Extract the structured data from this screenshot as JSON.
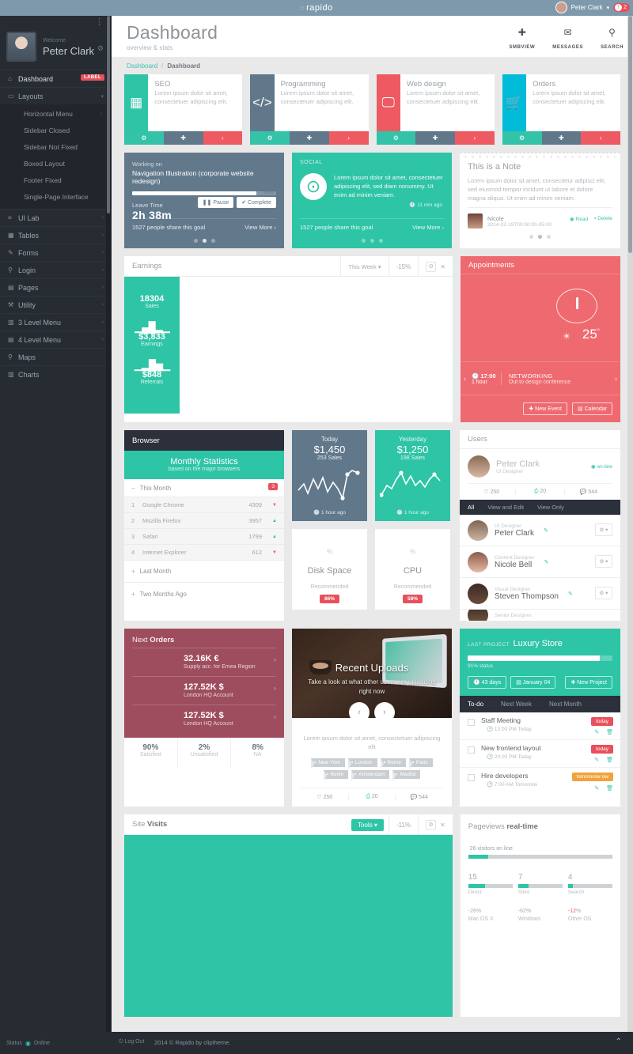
{
  "topbar": {
    "brand": "rapido",
    "user_name": "Peter Clark",
    "alert_count": "2"
  },
  "sidebar": {
    "welcome": "Welcome",
    "user": "Peter Clark",
    "dashboard": {
      "label": "Dashboard",
      "badge": "LABEL"
    },
    "layouts": {
      "label": "Layouts"
    },
    "layout_items": [
      {
        "label": "Horizontal Menu"
      },
      {
        "label": "Sidebar Closed"
      },
      {
        "label": "Sidebar Not Fixed"
      },
      {
        "label": "Boxed Layout"
      },
      {
        "label": "Footer Fixed"
      },
      {
        "label": "Single-Page Interface"
      }
    ],
    "items": [
      {
        "label": "UI Lab"
      },
      {
        "label": "Tables"
      },
      {
        "label": "Forms"
      },
      {
        "label": "Login"
      },
      {
        "label": "Pages"
      },
      {
        "label": "Utility"
      },
      {
        "label": "3 Level Menu"
      },
      {
        "label": "4 Level Menu"
      },
      {
        "label": "Maps"
      },
      {
        "label": "Charts"
      }
    ]
  },
  "page": {
    "title": "Dashboard",
    "subtitle": "overview & stats",
    "actions": [
      {
        "label": "SMBVIEW"
      },
      {
        "label": "MESSAGES"
      },
      {
        "label": "SEARCH"
      }
    ],
    "breadcrumb_root": "Dashboard",
    "breadcrumb_sep": "/",
    "breadcrumb_current": "Dashboard"
  },
  "services": [
    {
      "title": "SEO",
      "desc": "Lorem ipsum dolor sit amet, consectetuer adipiscing elit.",
      "color": "bg-teal"
    },
    {
      "title": "Programming",
      "desc": "Lorem ipsum dolor sit amet, consectetuer adipiscing elit.",
      "color": "bg-slate"
    },
    {
      "title": "Web design",
      "desc": "Lorem ipsum dolor sit amet, consectetuer adipiscing elit.",
      "color": "bg-red"
    },
    {
      "title": "Orders",
      "desc": "Lorem ipsum dolor sit amet, consectetuer adipiscing elit.",
      "color": "bg-cyan"
    }
  ],
  "working": {
    "label": "Working on",
    "title": "Navigation Illustration (corporate website redesign)",
    "progress": "86%",
    "leave_label": "Leave Time",
    "time": "2h 38m",
    "pause": "Pause",
    "complete": "Complete",
    "share_count": "1527",
    "share_text": "people share this goal",
    "view_more": "View More"
  },
  "social": {
    "label": "SOCIAL",
    "text": "Lorem ipsum dolor sit amet, consectetuer adipiscing elit, sed diam nonummy. Ut enim ad minim veniam.",
    "ago": "11 min ago",
    "share_count": "1527",
    "share_text": "people share this goal",
    "view_more": "View More"
  },
  "note": {
    "title": "This is a Note",
    "text": "Lorem ipsum dolor sit amet, consectetur adipisci elit, sed eiusmod tempor incidunt ut labore et dolore magna aliqua. Ut enim ad minim veniam.",
    "author": "Nicole",
    "date": "2014-02-19T00:00:00-05:00",
    "read": "Read",
    "delete": "Delete"
  },
  "earnings": {
    "title": "Earnings",
    "select": "This Week",
    "percent": "-15",
    "percent_unit": "%",
    "sales_value": "18304",
    "sales_label": "Sales",
    "earnings_value": "$3,833",
    "earnings_label": "Earnings",
    "referrals_value": "$848",
    "referrals_label": "Referrals"
  },
  "appointments": {
    "title": "Appointments",
    "temperature": "25",
    "temp_unit": "°",
    "time": "17:00",
    "time_sub": "1 hour",
    "event_title": "NETWORKING",
    "event_desc": "Out to design conference",
    "new_event": "New Event",
    "calendar": "Calendar"
  },
  "browser": {
    "title": "Browser",
    "stat_title": "Monthly Statistics",
    "stat_sub": "based on the major browsers",
    "this_month": "This Month",
    "badge": "3",
    "rows": [
      {
        "rank": "1",
        "name": "Google Chrome",
        "value": "4309",
        "dir": "down"
      },
      {
        "rank": "2",
        "name": "Mozilla Firefox",
        "value": "3957",
        "dir": "up"
      },
      {
        "rank": "3",
        "name": "Safari",
        "value": "1799",
        "dir": "up"
      },
      {
        "rank": "4",
        "name": "Internet Explorer",
        "value": "612",
        "dir": "down"
      }
    ],
    "last_month": "Last Month",
    "two_months": "Two Months Ago"
  },
  "sales": [
    {
      "day": "Today",
      "value": "$1,450",
      "count": "253 Sales",
      "ago": "1 hour ago",
      "color": "bg-slate"
    },
    {
      "day": "Yesterday",
      "value": "$1,250",
      "count": "198 Sales",
      "ago": "1 hour ago",
      "color": "bg-teal"
    }
  ],
  "stat_cards": [
    {
      "name": "Disk Space",
      "recommended": "Recommended",
      "badge": "86%"
    },
    {
      "name": "CPU",
      "recommended": "Recommended",
      "badge": "58%"
    }
  ],
  "users": {
    "title": "Users",
    "featured": {
      "name": "Peter Clark",
      "role": "UI Designer",
      "online": "on-line",
      "likes": "250",
      "shares": "20",
      "comments": "544"
    },
    "tabs": [
      {
        "label": "All"
      },
      {
        "label": "View and Edit"
      },
      {
        "label": "View Only"
      }
    ],
    "rows": [
      {
        "role": "UI Designer",
        "name": "Peter Clark"
      },
      {
        "role": "Content Designer",
        "name": "Nicole Bell"
      },
      {
        "role": "Visual Designer",
        "name": "Steven Thompson"
      },
      {
        "role": "Senior Designer",
        "name": ""
      }
    ]
  },
  "orders": {
    "title_light": "Next ",
    "title_bold": "Orders",
    "items": [
      {
        "value": "32.16K €",
        "desc": "Supply acc. for Emea Region"
      },
      {
        "value": "127.52K $",
        "desc": "London HQ Account"
      },
      {
        "value": "127.52K $",
        "desc": "London HQ Account"
      }
    ],
    "footer": [
      {
        "pct": "90%",
        "label": "Satisfied"
      },
      {
        "pct": "2%",
        "label": "Unsatisfied"
      },
      {
        "pct": "8%",
        "label": "NA"
      }
    ]
  },
  "uploads": {
    "title": "Recent Uploads",
    "subtitle": "Take a look at what other users are uploading right now",
    "text": "Lorem ipsum dolor sit amet, consectetuer adipiscing elit",
    "tags": [
      "New York",
      "London",
      "Rome",
      "Paris",
      "Berlin",
      "Amsterdam",
      "Madrid"
    ],
    "likes": "250",
    "shares": "20",
    "comments": "544"
  },
  "project": {
    "label": "LAST PROJECT",
    "name": "Luxury Store",
    "progress": "91%",
    "status": "91% status",
    "days": "43 days",
    "date": "January 04",
    "new_project": "New Project",
    "tabs": [
      {
        "label": "To-do"
      },
      {
        "label": "Next Week"
      },
      {
        "label": "Next Month"
      }
    ],
    "todos": [
      {
        "title": "Staff Meeting",
        "when": "13:00 PM Today",
        "badge": "today",
        "badge_color": "bg-today"
      },
      {
        "title": "New frontend layout",
        "when": "20:00 PM Today",
        "badge": "today",
        "badge_color": "bg-today"
      },
      {
        "title": "Hire developers",
        "when": "7:00 AM Tomorrow",
        "badge": "tommorow ow",
        "badge_color": "bg-tom"
      }
    ]
  },
  "visits": {
    "title_light": "Site ",
    "title_bold": "Visits",
    "tools": "Tools",
    "percent": "-11",
    "percent_unit": "%"
  },
  "pageviews": {
    "title_light": "Pageviews ",
    "title_bold": "real-time",
    "online_count": "26",
    "online_label": "visitors on line",
    "online_pct": 14,
    "columns": [
      {
        "n": "15",
        "label": "Direct",
        "pct": 38,
        "big": "-26",
        "unit": "%",
        "os": "Mac OS X"
      },
      {
        "n": "7",
        "label": "Sites",
        "pct": 24,
        "big": "-62",
        "unit": "%",
        "os": "Windows"
      },
      {
        "n": "4",
        "label": "Search",
        "pct": 11,
        "big": "-12",
        "unit": "%",
        "os": "Other OS"
      }
    ]
  },
  "footer": {
    "status_label": "Status",
    "status": "Online",
    "logout": "Log Out",
    "copyright": "2014 © Rapido by cliptheme."
  }
}
